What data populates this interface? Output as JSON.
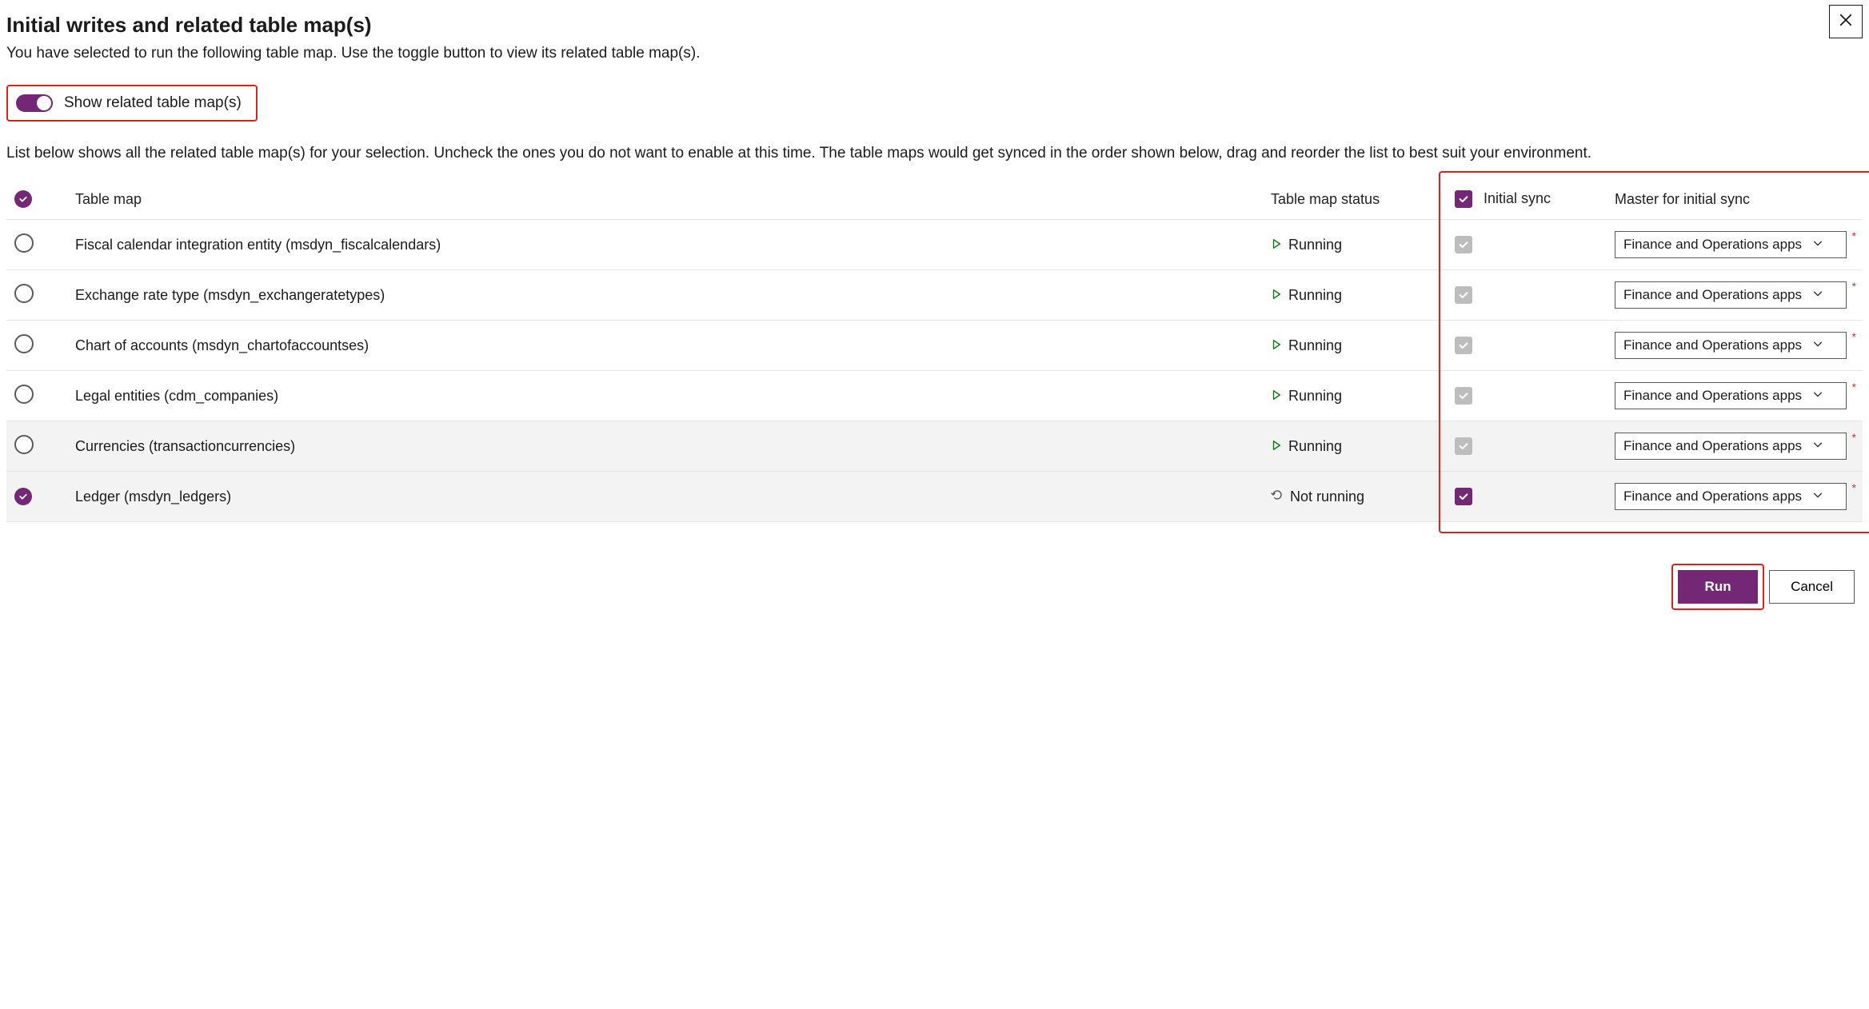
{
  "title": "Initial writes and related table map(s)",
  "subtitle": "You have selected to run the following table map. Use the toggle button to view its related table map(s).",
  "toggle_label": "Show related table map(s)",
  "list_desc": "List below shows all the related table map(s) for your selection. Uncheck the ones you do not want to enable at this time. The table maps would get synced in the order shown below, drag and reorder the list to best suit your environment.",
  "columns": {
    "name": "Table map",
    "status": "Table map status",
    "sync": "Initial sync",
    "master": "Master for initial sync"
  },
  "status_labels": {
    "running": "Running",
    "not_running": "Not running"
  },
  "master_default": "Finance and Operations apps",
  "rows": [
    {
      "name": "Fiscal calendar integration entity (msdyn_fiscalcalendars)",
      "status": "running",
      "sync": "disabled",
      "selected": false
    },
    {
      "name": "Exchange rate type (msdyn_exchangeratetypes)",
      "status": "running",
      "sync": "disabled",
      "selected": false
    },
    {
      "name": "Chart of accounts (msdyn_chartofaccountses)",
      "status": "running",
      "sync": "disabled",
      "selected": false
    },
    {
      "name": "Legal entities (cdm_companies)",
      "status": "running",
      "sync": "disabled",
      "selected": false
    },
    {
      "name": "Currencies (transactioncurrencies)",
      "status": "running",
      "sync": "disabled",
      "selected": false,
      "alt": true
    },
    {
      "name": "Ledger (msdyn_ledgers)",
      "status": "not_running",
      "sync": "checked",
      "selected": true,
      "alt": true
    }
  ],
  "buttons": {
    "run": "Run",
    "cancel": "Cancel"
  }
}
